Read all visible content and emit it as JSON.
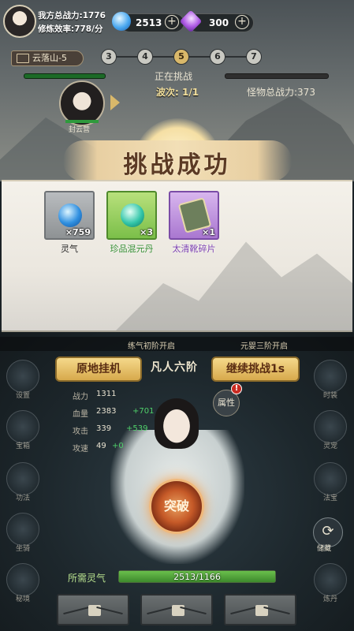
{
  "header": {
    "power_label": "我方总战力:1776",
    "efficiency_label": "修炼效率:778/分",
    "spirit_stones": "2513",
    "gems": "300",
    "plus": "+"
  },
  "stage": {
    "name": "云落山-5",
    "waves": [
      "3",
      "4",
      "5",
      "6",
      "7"
    ],
    "active_wave_index": 2,
    "status": "正在挑战",
    "wave_progress": "波次: 1/1",
    "monster_power": "怪物总战力:373",
    "hero_name": "封云营"
  },
  "result": {
    "banner": "挑战成功",
    "rewards": [
      {
        "name": "灵气",
        "qty": "×759",
        "rarity": "gray",
        "icon": "blue-orb-icon"
      },
      {
        "name": "珍品混元丹",
        "qty": "×3",
        "rarity": "green",
        "icon": "teal-pill-icon"
      },
      {
        "name": "太清靴碎片",
        "qty": "×1",
        "rarity": "purple",
        "icon": "boots-fragment-icon"
      }
    ],
    "name_colors": {
      "gray": "#2c2a27",
      "green": "#2f8a2d",
      "purple": "#7b3fb0"
    }
  },
  "unlocks": [
    "练气初阶开启",
    "元婴三阶开启"
  ],
  "actions": {
    "idle": "原地挂机",
    "continue": "继续挑战1s",
    "realm": "凡人六阶"
  },
  "attributes": [
    {
      "label": "战力",
      "value": "1311",
      "bonus": ""
    },
    {
      "label": "血量",
      "value": "2383",
      "bonus": "+701"
    },
    {
      "label": "攻击",
      "value": "339",
      "bonus": "+539"
    },
    {
      "label": "攻速",
      "value": "49",
      "bonus": "+0"
    }
  ],
  "attr_button": "属性",
  "alert": "!",
  "side_left": [
    "设置",
    "宝箱",
    "功法",
    "坐骑",
    "秘境"
  ],
  "side_right": [
    "时装",
    "灵宠",
    "法宝",
    "炼丹"
  ],
  "breakthrough": "突破",
  "stash": {
    "label": "储藏",
    "glyph": "⟳"
  },
  "cultivation": {
    "label": "所需灵气",
    "current": 2513,
    "required": 1166,
    "text": "2513/1166"
  }
}
